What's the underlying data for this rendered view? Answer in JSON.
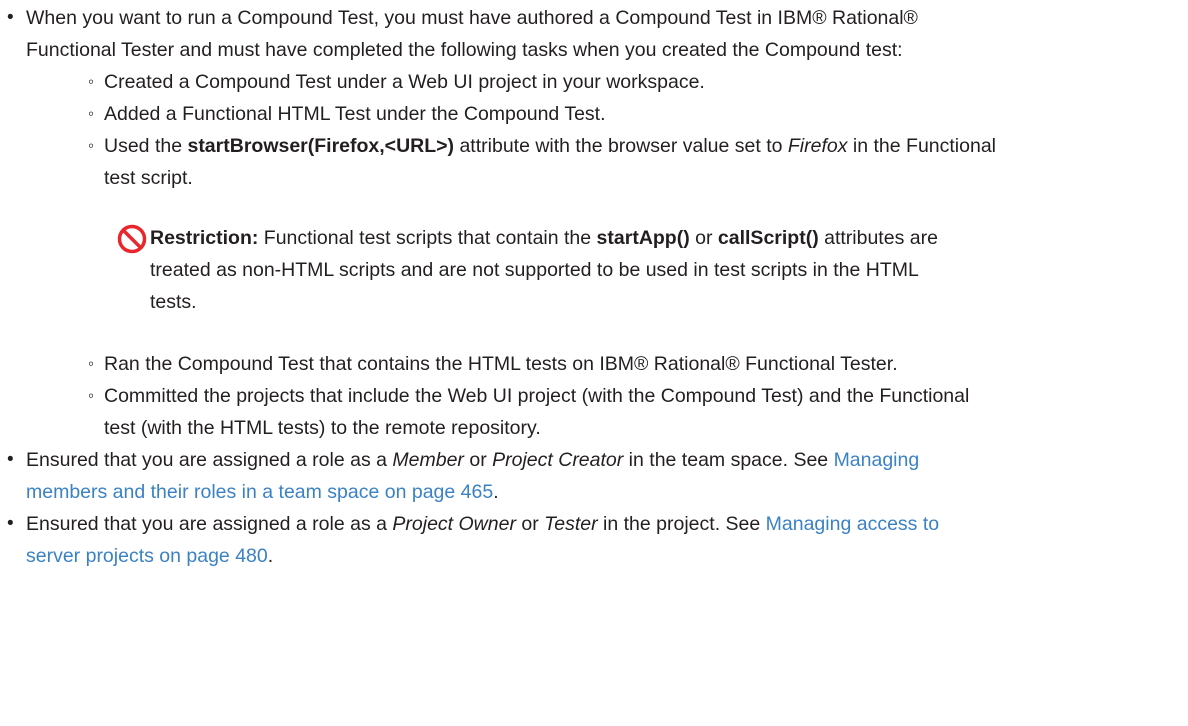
{
  "bullets": [
    {
      "text_1": "When you want to run a Compound Test, you must have authored a Compound Test in IBM® Rational®",
      "text_2": "Functional Tester and must have completed the following tasks when you created the Compound test:",
      "sub": [
        {
          "text": "Created a Compound Test under a Web UI project in your workspace."
        },
        {
          "text": "Added a Functional HTML Test under the Compound Test."
        },
        {
          "pre": "Used the ",
          "bold": "startBrowser(Firefox,<URL>)",
          "mid": " attribute with the browser value set to ",
          "italic": "Firefox",
          "post": " in the Functional",
          "line2": "test script."
        }
      ]
    }
  ],
  "restriction": {
    "icon": "restriction-icon",
    "label": "Restriction:",
    "pre": " Functional test scripts that contain the ",
    "bold_1": "startApp()",
    "mid": " or ",
    "bold_2": "callScript()",
    "post": " attributes are",
    "line2": "treated as non-HTML scripts and are not supported to be used in test scripts in the HTML",
    "line3": "tests."
  },
  "sub_after": [
    {
      "text": "Ran the Compound Test that contains the HTML tests on IBM® Rational® Functional Tester."
    },
    {
      "line1": "Committed the projects that include the Web UI project (with the Compound Test) and the Functional",
      "line2": "test (with the HTML tests) to the remote repository."
    }
  ],
  "bullet_2": {
    "pre": "Ensured that you are assigned a role as a ",
    "italic_1": "Member",
    "mid": " or ",
    "italic_2": "Project Creator",
    "post": " in the team space. See ",
    "link_1": "Managing",
    "link_2": "members and their roles in a team space on page 465",
    "end": "."
  },
  "bullet_3": {
    "pre": "Ensured that you are assigned a role as a ",
    "italic_1": "Project Owner",
    "mid": " or ",
    "italic_2": "Tester",
    "post": " in the project. See ",
    "link_1": "Managing access to",
    "link_2": "server projects on page 480",
    "end": "."
  },
  "colors": {
    "text": "#231f20",
    "link": "#3b82c4",
    "restriction_icon": "#e8262c"
  }
}
